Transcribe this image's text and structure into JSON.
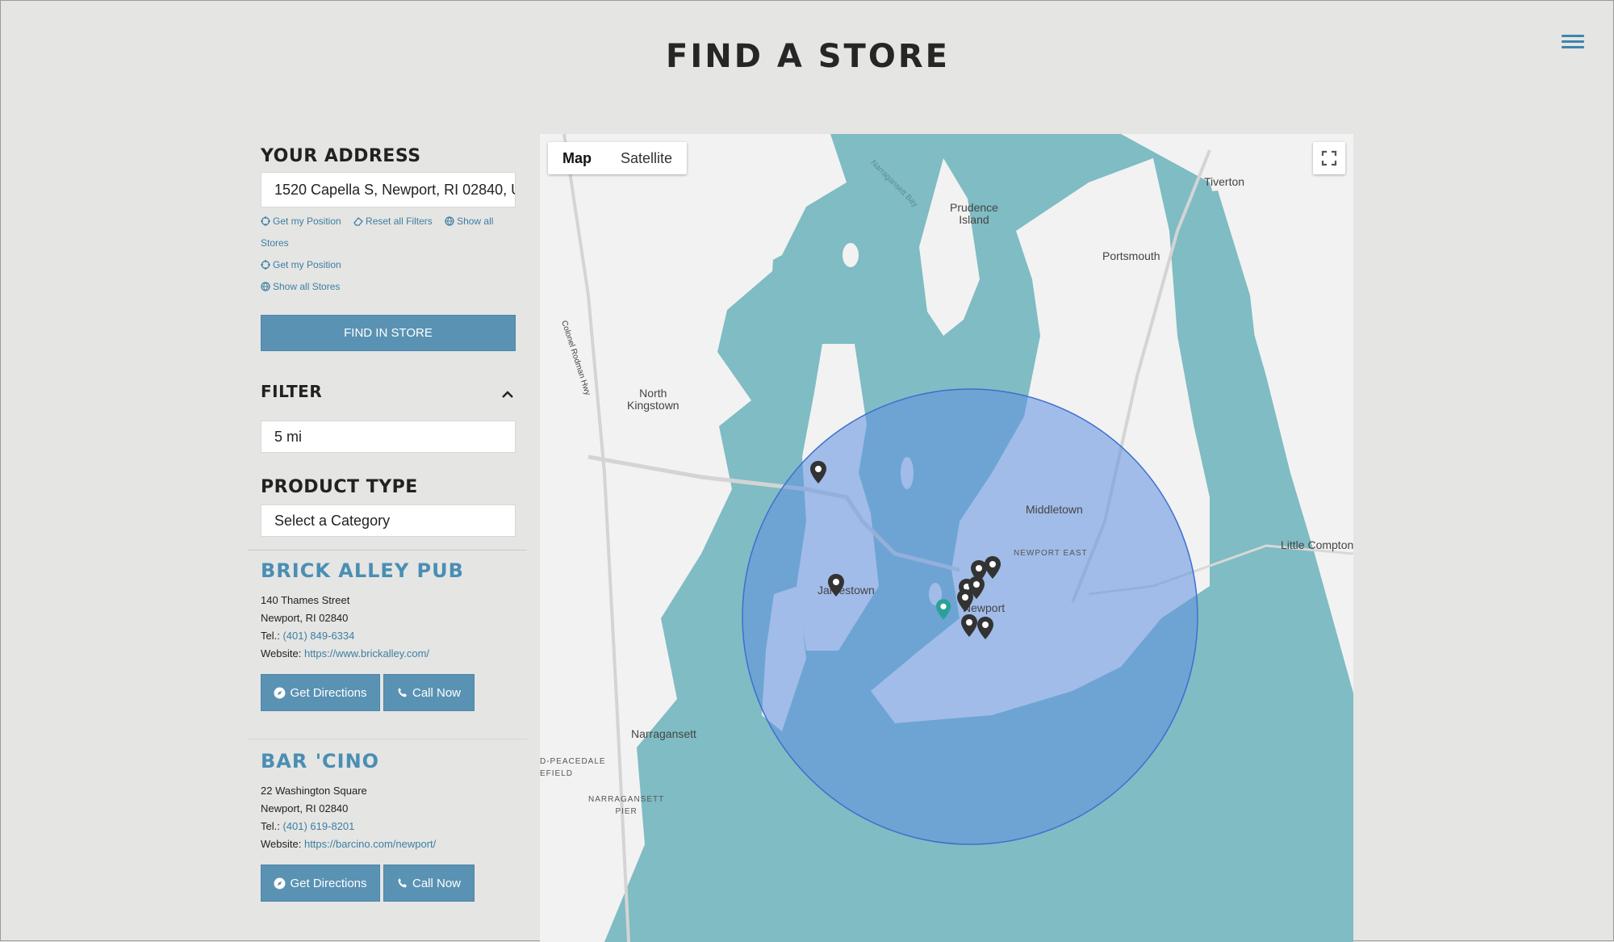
{
  "header": {
    "title": "FIND A STORE"
  },
  "sidebar": {
    "address_heading": "YOUR ADDRESS",
    "address_value": "1520 Capella S, Newport, RI 02840, U",
    "links": {
      "get_position": "Get my Position",
      "reset_filters": "Reset all Filters",
      "show_all": "Show all",
      "stores": "Stores",
      "get_position_2": "Get my Position",
      "show_all_stores": "Show all Stores"
    },
    "find_button": "FIND IN STORE",
    "filter_heading": "FILTER",
    "radius_value": "5 mi",
    "product_heading": "PRODUCT TYPE",
    "category_value": "Select a Category"
  },
  "stores": [
    {
      "name": "BRICK ALLEY PUB",
      "street": "140 Thames Street",
      "city": "Newport, RI 02840",
      "tel_label": "Tel.:",
      "tel": "(401) 849-6334",
      "web_label": "Website:",
      "website": "https://www.brickalley.com/",
      "directions": "Get Directions",
      "call": "Call Now"
    },
    {
      "name": "BAR 'CINO",
      "street": "22 Washington Square",
      "city": "Newport, RI 02840",
      "tel_label": "Tel.:",
      "tel": "(401) 619-8201",
      "web_label": "Website:",
      "website": "https://barcino.com/newport/",
      "directions": "Get Directions",
      "call": "Call Now"
    }
  ],
  "map": {
    "type_map": "Map",
    "type_satellite": "Satellite",
    "labels": {
      "tiverton": "Tiverton",
      "prudence": "Prudence\nIsland",
      "portsmouth": "Portsmouth",
      "north_kingstown": "North\nKingstown",
      "middletown": "Middletown",
      "newport_east": "NEWPORT EAST",
      "little_compton": "Little Compton",
      "jamestown": "Jamestown",
      "newport": "Newport",
      "narragansett": "Narragansett",
      "peacedale": "D-PEACEDALE\nEFIELD",
      "narr_pier": "NARRAGANSETT\nPIER",
      "colonel_rodman": "Colonel Rodman Hwy",
      "narr_bay": "Narragansett Bay"
    },
    "colors": {
      "water": "#7fbcc4",
      "land": "#f2f2f2",
      "radius_fill": "#5f8fe0",
      "pin": "#333333",
      "user_pin": "#2aa198"
    }
  }
}
